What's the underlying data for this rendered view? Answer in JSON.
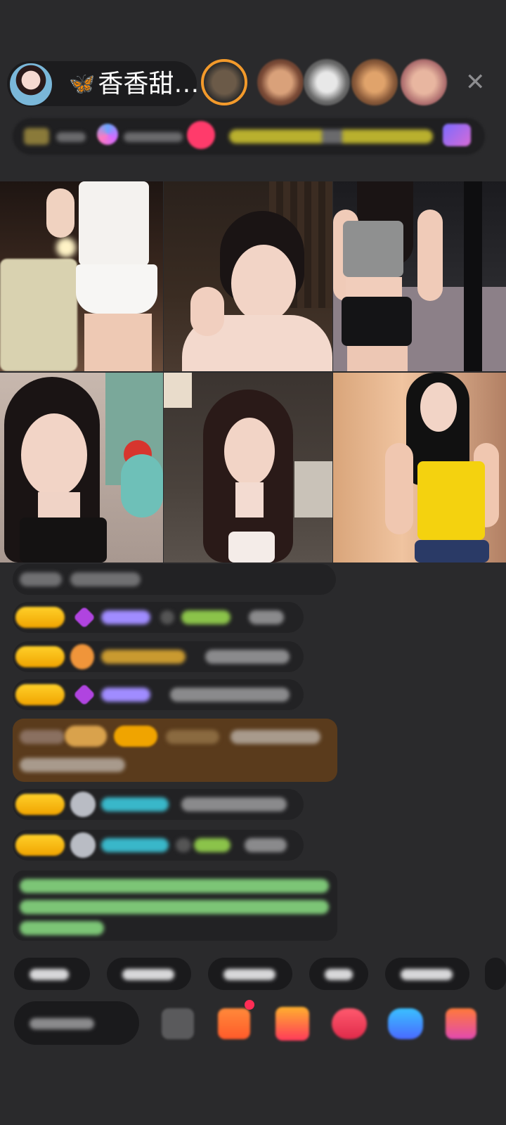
{
  "header": {
    "host_name": "香香甜…",
    "name_icon": "butterfly-icon",
    "close_glyph": "✕",
    "close_icon": "close-icon"
  },
  "colors": {
    "background": "#2a2a2c",
    "badge_gold": "#f0a400",
    "name_purple": "#a08cff",
    "name_green": "#8bc34a",
    "name_cyan": "#39b7c9",
    "system_green": "#7cc576",
    "gift_banner": "#5a3b1c"
  }
}
